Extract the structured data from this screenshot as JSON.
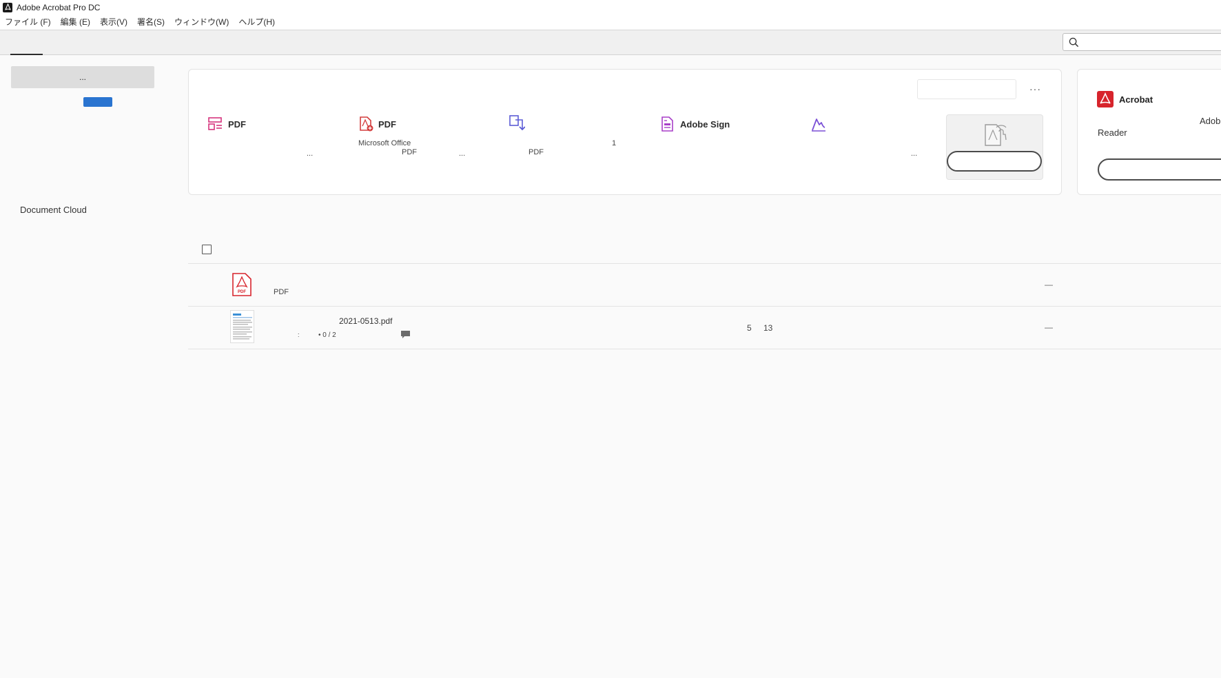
{
  "window": {
    "title": "Adobe Acrobat Pro DC"
  },
  "menu": {
    "items": [
      "ファイル (F)",
      "編集 (E)",
      "表示(V)",
      "署名(S)",
      "ウィンドウ(W)",
      "ヘルプ(H)"
    ]
  },
  "sidebar": {
    "top_button_label": "...",
    "document_cloud_label": "Document Cloud"
  },
  "tools": {
    "more_label": "···",
    "items": [
      {
        "icon": "form-icon",
        "label": "PDF",
        "sub": [
          "..."
        ],
        "color": "#d6347d"
      },
      {
        "icon": "create-pdf-icon",
        "label": "PDF",
        "sub": [
          "Microsoft Office",
          "PDF",
          "..."
        ],
        "color": "#d33d3d"
      },
      {
        "icon": "export-pdf-icon",
        "label": "",
        "sub": [
          "PDF",
          "1"
        ],
        "color": "#5b5bd6"
      },
      {
        "icon": "adobe-sign-icon",
        "label": "Adobe Sign",
        "sub": [],
        "color": "#a83fc8"
      },
      {
        "icon": "fill-sign-icon",
        "label": "",
        "sub": [
          "..."
        ],
        "color": "#7a4fd6"
      }
    ]
  },
  "promo": {
    "title": "Acrobat",
    "adobe_text": "Adob",
    "reader_text": "Reader"
  },
  "files": {
    "rows": [
      {
        "type_label": "PDF",
        "dash": "—"
      },
      {
        "name": "2021-0513.pdf",
        "colon": ":",
        "progress": "• 0 / 2",
        "col_a": "5",
        "col_b": "13",
        "dash": "—"
      }
    ]
  },
  "colors": {
    "accent_blue": "#2a74d0",
    "acrobat_red": "#d7242c"
  }
}
